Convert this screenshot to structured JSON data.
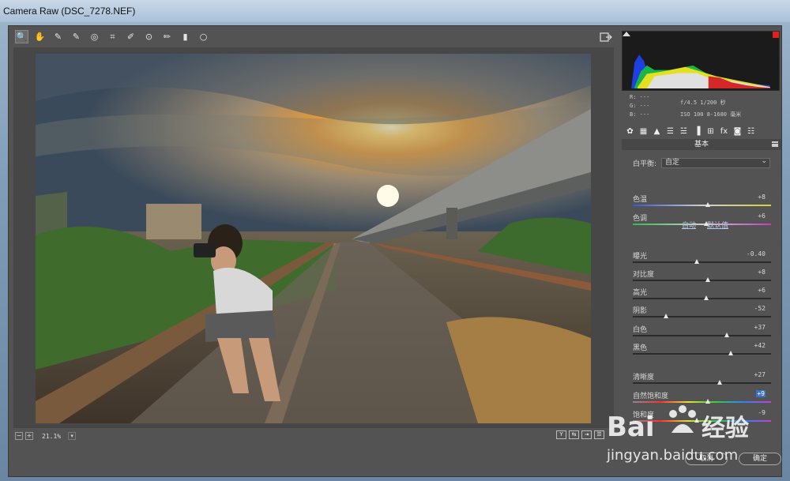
{
  "window": {
    "title": "Camera Raw (DSC_7278.NEF)"
  },
  "toolbar": {
    "tools": [
      {
        "name": "zoom-tool",
        "glyph": "🔍"
      },
      {
        "name": "hand-tool",
        "glyph": "✋"
      },
      {
        "name": "white-balance-tool",
        "glyph": "✎"
      },
      {
        "name": "color-sampler-tool",
        "glyph": "✎"
      },
      {
        "name": "targeted-adjustment-tool",
        "glyph": "◎"
      },
      {
        "name": "crop-tool",
        "glyph": "⌗"
      },
      {
        "name": "spot-removal-tool",
        "glyph": "✐"
      },
      {
        "name": "red-eye-tool",
        "glyph": "⊙"
      },
      {
        "name": "adjustment-brush-tool",
        "glyph": "✏"
      },
      {
        "name": "graduated-filter-tool",
        "glyph": "▮"
      },
      {
        "name": "radial-filter-tool",
        "glyph": "○"
      }
    ]
  },
  "status": {
    "zoom": "21.1%",
    "zoom_out": "−",
    "zoom_in": "+",
    "zoom_dropdown": "▾",
    "view_buttons": [
      "Y",
      "⇆",
      "⇥",
      "☰"
    ]
  },
  "readout": {
    "r": "R:  ---",
    "g": "G:  ---",
    "b": "B:  ---",
    "aperture_shutter": "f/4.5  1/200 秒",
    "iso_lens": "ISO 100  8-1680 毫米"
  },
  "panel": {
    "title": "基本",
    "tabs": [
      "✿",
      "▦",
      "▲",
      "☰",
      "☱",
      "▐",
      "⊞",
      "fx",
      "◙",
      "☷"
    ],
    "white_balance_label": "白平衡:",
    "white_balance_value": "自定",
    "auto_label": "自动",
    "default_label": "默认值",
    "sliders": [
      {
        "label": "色温",
        "value": "+8",
        "pos": 0.54,
        "track": "temp"
      },
      {
        "label": "色调",
        "value": "+6",
        "pos": 0.53,
        "track": "tint"
      },
      {
        "label": "曝光",
        "value": "-0.40",
        "pos": 0.46,
        "track": ""
      },
      {
        "label": "对比度",
        "value": "+8",
        "pos": 0.54,
        "track": ""
      },
      {
        "label": "高光",
        "value": "+6",
        "pos": 0.53,
        "track": ""
      },
      {
        "label": "阴影",
        "value": "-52",
        "pos": 0.24,
        "track": ""
      },
      {
        "label": "白色",
        "value": "+37",
        "pos": 0.68,
        "track": ""
      },
      {
        "label": "黑色",
        "value": "+42",
        "pos": 0.71,
        "track": ""
      },
      {
        "label": "清晰度",
        "value": "+27",
        "pos": 0.63,
        "track": ""
      },
      {
        "label": "自然饱和度",
        "value": "+9",
        "pos": 0.54,
        "track": "vib",
        "highlight": true
      },
      {
        "label": "饱和度",
        "value": "-9",
        "pos": 0.46,
        "track": "sat"
      }
    ]
  },
  "buttons": {
    "cancel": "取消",
    "ok": "确定"
  },
  "watermark": {
    "brand": "Baidu经验",
    "url": "jingyan.baidu.com"
  },
  "colors": {
    "panel_bg": "#535353",
    "canvas_bg": "#474747",
    "accent": "#3b72c6"
  }
}
